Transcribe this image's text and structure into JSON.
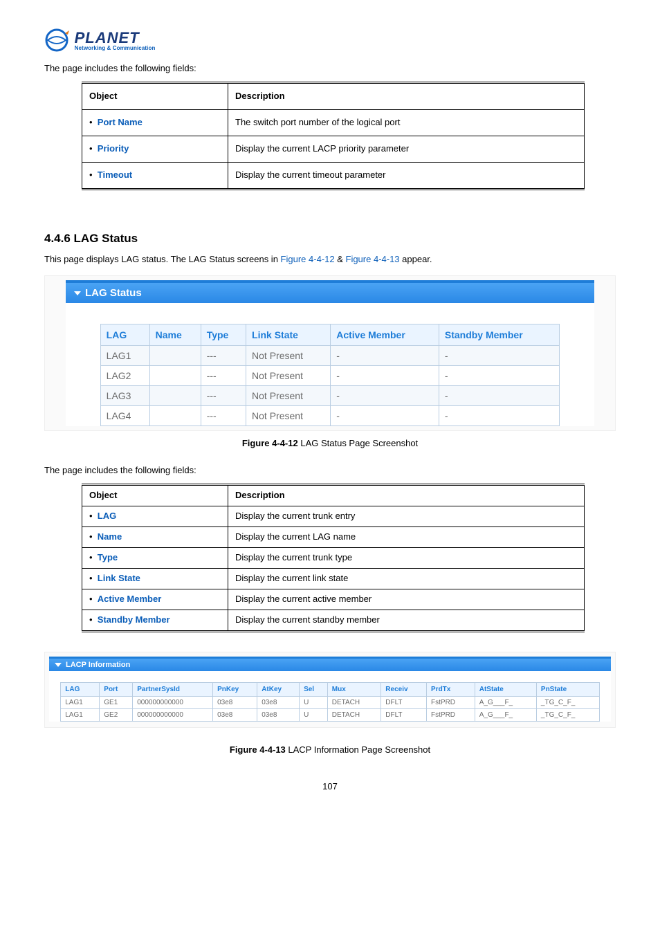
{
  "logo": {
    "title": "PLANET",
    "sub": "Networking & Communication"
  },
  "intro1": "The page includes the following fields:",
  "table1": {
    "head_object": "Object",
    "head_description": "Description",
    "rows": [
      {
        "obj": "Port Name",
        "desc": "The switch port number of the logical port"
      },
      {
        "obj": "Priority",
        "desc": "Display the current LACP priority parameter"
      },
      {
        "obj": "Timeout",
        "desc": "Display the current timeout parameter"
      }
    ]
  },
  "section": {
    "num": "4.4.6 LAG Status",
    "text_pre": "This page displays LAG status. The LAG Status screens in ",
    "link1": "Figure 4-4-12",
    "amp": " & ",
    "link2": "Figure 4-4-13",
    "text_post": " appear."
  },
  "lag_panel": {
    "title": "LAG Status",
    "headers": [
      "LAG",
      "Name",
      "Type",
      "Link State",
      "Active Member",
      "Standby Member"
    ],
    "rows": [
      {
        "lag": "LAG1",
        "name": "",
        "type": "---",
        "link": "Not Present",
        "active": "-",
        "standby": "-"
      },
      {
        "lag": "LAG2",
        "name": "",
        "type": "---",
        "link": "Not Present",
        "active": "-",
        "standby": "-"
      },
      {
        "lag": "LAG3",
        "name": "",
        "type": "---",
        "link": "Not Present",
        "active": "-",
        "standby": "-"
      },
      {
        "lag": "LAG4",
        "name": "",
        "type": "---",
        "link": "Not Present",
        "active": "-",
        "standby": "-"
      }
    ]
  },
  "fig1": {
    "num": "Figure 4-4-12",
    "text": " LAG Status Page Screenshot"
  },
  "intro2": "The page includes the following fields:",
  "table2": {
    "head_object": "Object",
    "head_description": "Description",
    "rows": [
      {
        "obj": "LAG",
        "desc": "Display the current trunk entry"
      },
      {
        "obj": "Name",
        "desc": "Display the current LAG name"
      },
      {
        "obj": "Type",
        "desc": "Display the current trunk type"
      },
      {
        "obj": "Link State",
        "desc": "Display the current link state"
      },
      {
        "obj": "Active Member",
        "desc": "Display the current active member"
      },
      {
        "obj": "Standby Member",
        "desc": "Display the current standby member"
      }
    ]
  },
  "lacp_panel": {
    "title": "LACP Information",
    "headers": [
      "LAG",
      "Port",
      "PartnerSysId",
      "PnKey",
      "AtKey",
      "Sel",
      "Mux",
      "Receiv",
      "PrdTx",
      "AtState",
      "PnState"
    ],
    "rows": [
      {
        "c": [
          "LAG1",
          "GE1",
          "000000000000",
          "03e8",
          "03e8",
          "U",
          "DETACH",
          "DFLT",
          "FstPRD",
          "A_G___F_",
          "_TG_C_F_"
        ]
      },
      {
        "c": [
          "LAG1",
          "GE2",
          "000000000000",
          "03e8",
          "03e8",
          "U",
          "DETACH",
          "DFLT",
          "FstPRD",
          "A_G___F_",
          "_TG_C_F_"
        ]
      }
    ]
  },
  "fig2": {
    "num": "Figure 4-4-13",
    "text": " LACP Information Page Screenshot"
  },
  "page_num": "107"
}
